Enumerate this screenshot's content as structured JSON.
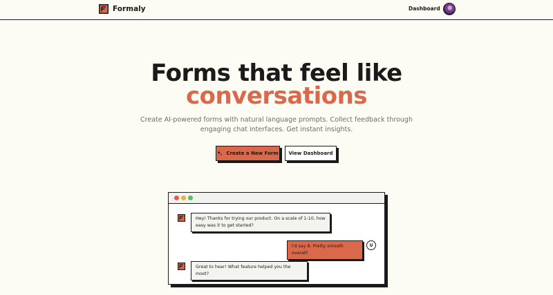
{
  "header": {
    "brand_name": "Formaly",
    "nav_dashboard": "Dashboard",
    "avatar_icon": "user-avatar"
  },
  "hero": {
    "line1": "Forms that feel like",
    "line2": "conversations",
    "subtitle_line1": "Create AI-powered forms with natural language prompts. Collect feedback through",
    "subtitle_line2": "engaging chat interfaces. Get instant insights."
  },
  "actions": {
    "primary_label": "Create a New Form",
    "primary_icon": "sparkle-icon",
    "secondary_label": "View Dashboard"
  },
  "chat": {
    "messages": [
      {
        "role": "bot",
        "text_line1": "Hey! Thanks for trying our product. On a scale of 1-10, how",
        "text_line2": "easy was it to get started?"
      },
      {
        "role": "user",
        "text": "I'd say 8. Pretty smooth overall!",
        "avatar_letter": "U"
      },
      {
        "role": "bot",
        "text": "Great to hear! What feature helped you the most?"
      }
    ]
  },
  "colors": {
    "background": "#fdfcf4",
    "accent": "#d9694a",
    "ink": "#1a1a1a",
    "muted_text": "#6b6b6b"
  }
}
